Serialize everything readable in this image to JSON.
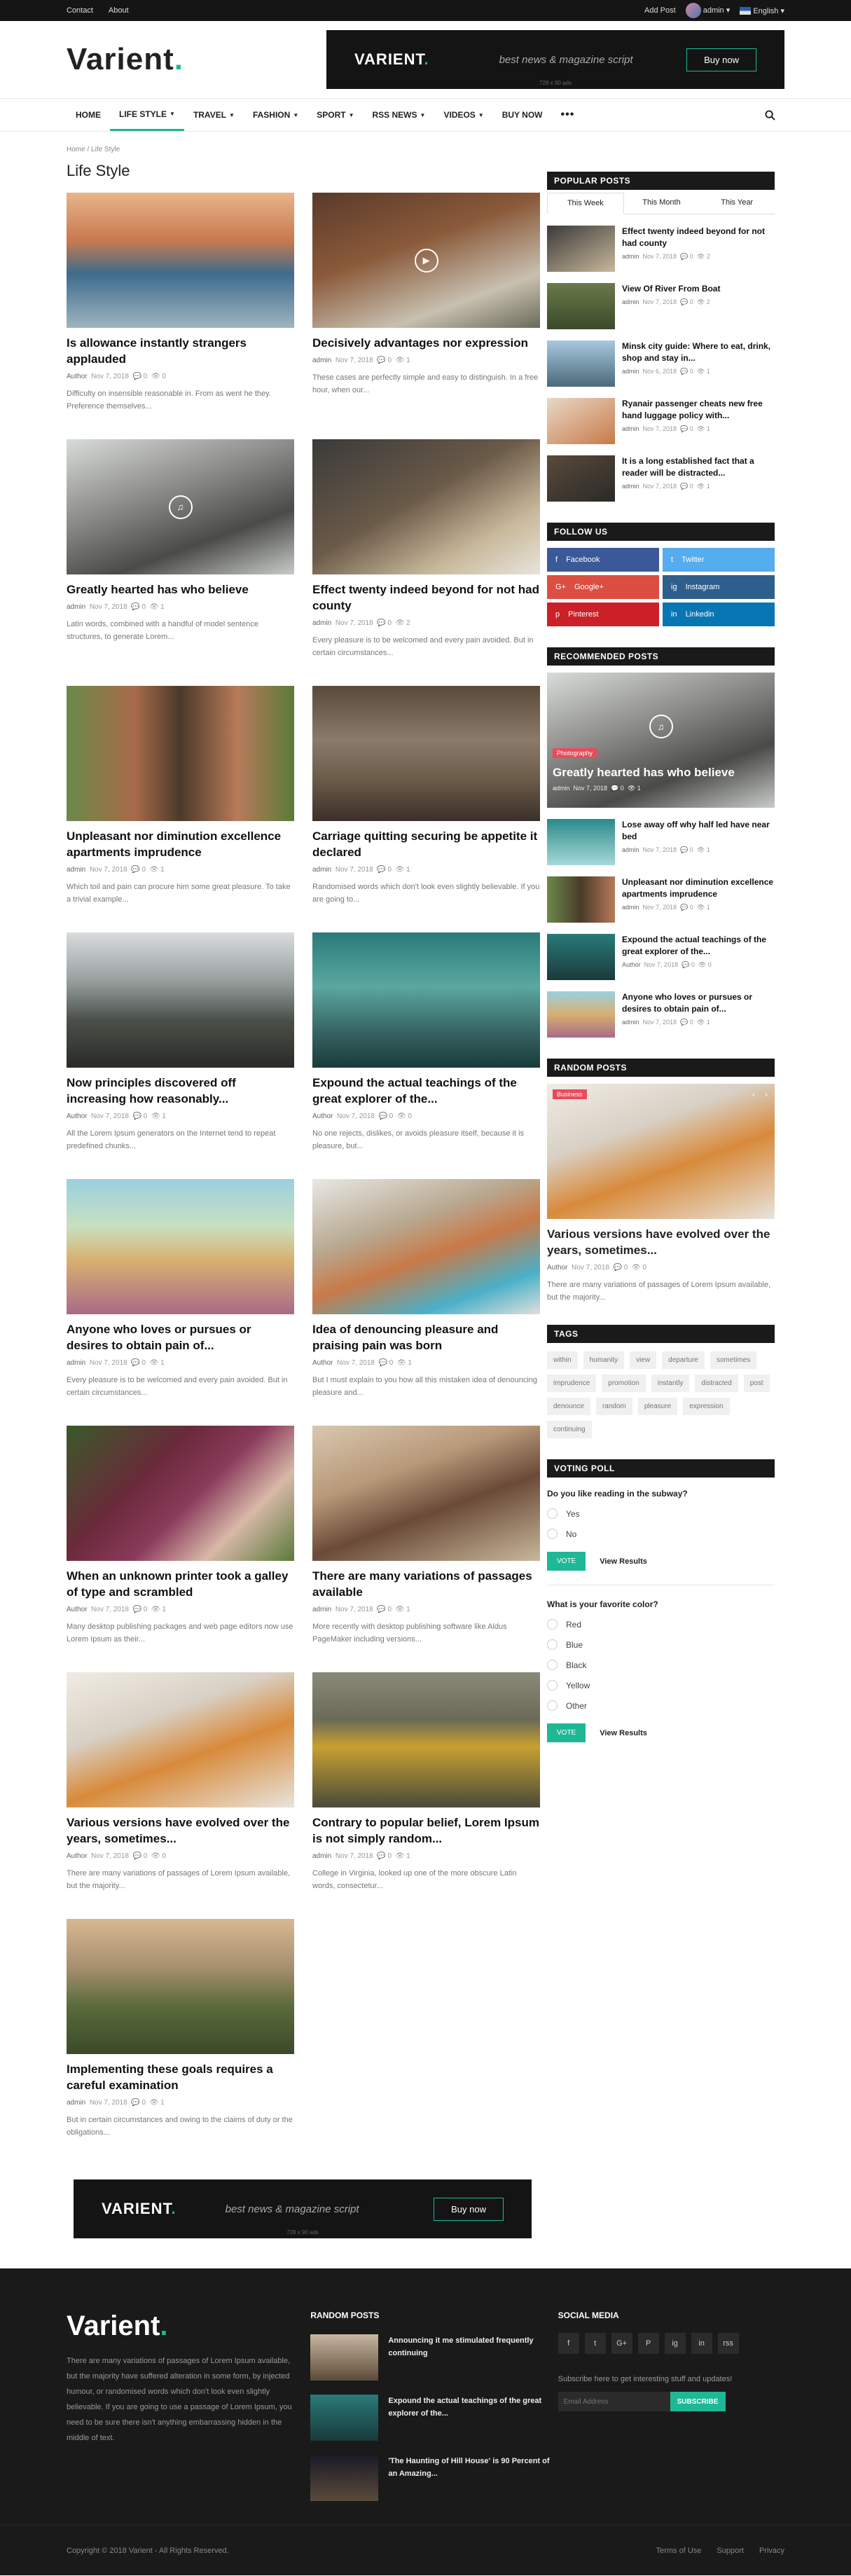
{
  "topbar": {
    "links": [
      "Contact",
      "About"
    ],
    "add_post": "Add Post",
    "user": "admin",
    "language": "English"
  },
  "header": {
    "logo": "Varient",
    "banner": {
      "name": "VARIENT",
      "tagline": "best news & magazine script",
      "button": "Buy now",
      "size": "728 x 90 ads"
    }
  },
  "nav": {
    "items": [
      {
        "label": "HOME",
        "caret": false
      },
      {
        "label": "LIFE STYLE",
        "caret": true
      },
      {
        "label": "TRAVEL",
        "caret": true
      },
      {
        "label": "FASHION",
        "caret": true
      },
      {
        "label": "SPORT",
        "caret": true
      },
      {
        "label": "RSS NEWS",
        "caret": true
      },
      {
        "label": "VIDEOS",
        "caret": true
      },
      {
        "label": "BUY NOW",
        "caret": false
      }
    ],
    "more": "•••"
  },
  "breadcrumb": {
    "home": "Home",
    "sep": "/",
    "current": "Life Style"
  },
  "page_title": "Life Style",
  "posts": [
    {
      "title": "Is allowance instantly strangers applauded",
      "author": "Author",
      "date": "Nov 7, 2018",
      "comments": "0",
      "views": "0",
      "excerpt": "Difficulty on insensible reasonable in. From as went he they. Preference themselves...",
      "img": "linear-gradient(180deg,#e8b48a 0%,#c97a4f 35%,#3d6c8c 60%,#9fb4c0 100%)",
      "media": "none"
    },
    {
      "title": "Decisively advantages nor expression",
      "author": "admin",
      "date": "Nov 7, 2018",
      "comments": "0",
      "views": "1",
      "excerpt": "These cases are perfectly simple and easy to distinguish. In a free hour, when our...",
      "img": "linear-gradient(160deg,#5a3a2a 0%,#8a5a3a 40%,#c8c0b0 75%,#6a6a5a 100%)",
      "media": "play"
    },
    {
      "title": "Greatly hearted has who believe",
      "author": "admin",
      "date": "Nov 7, 2018",
      "comments": "0",
      "views": "1",
      "excerpt": "Latin words, combined with a handful of model sentence structures, to generate Lorem...",
      "img": "linear-gradient(160deg,#d8dcd8 0%,#8a8a88 40%,#4a4a48 70%,#c8ccc8 100%)",
      "media": "music"
    },
    {
      "title": "Effect twenty indeed beyond for not had county",
      "author": "admin",
      "date": "Nov 7, 2018",
      "comments": "0",
      "views": "2",
      "excerpt": "Every pleasure is to be welcomed and every pain avoided. But in certain circumstances...",
      "img": "linear-gradient(150deg,#3a3a3a 0%,#6a5a48 45%,#c8b89a 75%,#e8e4dc 100%)",
      "media": "none"
    },
    {
      "title": "Unpleasant nor diminution excellence apartments imprudence",
      "author": "admin",
      "date": "Nov 7, 2018",
      "comments": "0",
      "views": "1",
      "excerpt": "Which toil and pain can procure him some great pleasure. To take a trivial example...",
      "img": "linear-gradient(90deg,#6a8a4a 0%,#a86a4a 30%,#4a3a2a 50%,#b87a5a 75%,#5a7a3a 100%)",
      "media": "none"
    },
    {
      "title": "Carriage quitting securing be appetite it declared",
      "author": "admin",
      "date": "Nov 7, 2018",
      "comments": "0",
      "views": "1",
      "excerpt": "Randomised words which don't look even slightly believable. If you are going to...",
      "img": "linear-gradient(180deg,#5a4a3a 0%,#8a7a6a 40%,#6a5a48 70%,#3a3028 100%)",
      "media": "none"
    },
    {
      "title": "Now principles discovered off increasing how reasonably...",
      "author": "Author",
      "date": "Nov 7, 2018",
      "comments": "0",
      "views": "1",
      "excerpt": "All the Lorem Ipsum generators on the Internet tend to repeat predefined chunks...",
      "img": "linear-gradient(180deg,#d8dcdc 0%,#9aa0a0 35%,#4a5048 65%,#2a2a28 100%)",
      "media": "none"
    },
    {
      "title": "Expound the actual teachings of the great explorer of the...",
      "author": "Author",
      "date": "Nov 7, 2018",
      "comments": "0",
      "views": "0",
      "excerpt": "No one rejects, dislikes, or avoids pleasure itself, because it is pleasure, but...",
      "img": "linear-gradient(180deg,#2a7a7a 0%,#5aa8a0 40%,#3a6a68 70%,#1a3a3a 100%)",
      "media": "none"
    },
    {
      "title": "Anyone who loves or pursues or desires to obtain pain of...",
      "author": "admin",
      "date": "Nov 7, 2018",
      "comments": "0",
      "views": "1",
      "excerpt": "Every pleasure is to be welcomed and every pain avoided. But in certain circumstances...",
      "img": "linear-gradient(180deg,#9ad0e0 0%,#c8e0c0 35%,#d8b070 60%,#a86a88 100%)",
      "media": "none"
    },
    {
      "title": "Idea of denouncing pleasure and praising pain was born",
      "author": "Author",
      "date": "Nov 7, 2018",
      "comments": "0",
      "views": "1",
      "excerpt": "But I must explain to you how all this mistaken idea of denouncing pleasure and...",
      "img": "linear-gradient(160deg,#e8e8e4 0%,#b8a890 35%,#c87a48 55%,#4ab0c8 80%,#e0e0dc 100%)",
      "media": "none"
    },
    {
      "title": "When an unknown printer took a galley of type and scrambled",
      "author": "Author",
      "date": "Nov 7, 2018",
      "comments": "0",
      "views": "1",
      "excerpt": "Many desktop publishing packages and web page editors now use Lorem Ipsum as their...",
      "img": "linear-gradient(135deg,#3a5a2a 0%,#6a2a3a 35%,#8a3a5a 55%,#d8b8a8 75%,#5a7a3a 100%)",
      "media": "none"
    },
    {
      "title": "There are many variations of passages available",
      "author": "admin",
      "date": "Nov 7, 2018",
      "comments": "0",
      "views": "1",
      "excerpt": "More recently with desktop publishing software like Aldus PageMaker including versions...",
      "img": "linear-gradient(160deg,#d8c8b0 0%,#b89878 35%,#6a4a38 60%,#c8b89a 100%)",
      "media": "none"
    },
    {
      "title": "Various versions have evolved over the years, sometimes...",
      "author": "Author",
      "date": "Nov 7, 2018",
      "comments": "0",
      "views": "0",
      "excerpt": "There are many variations of passages of Lorem Ipsum available, but the majority...",
      "img": "linear-gradient(160deg,#f0ece4 0%,#d8d0c4 35%,#d88a3a 60%,#e8e4dc 100%)",
      "media": "none"
    },
    {
      "title": "Contrary to popular belief, Lorem Ipsum is not simply random...",
      "author": "admin",
      "date": "Nov 7, 2018",
      "comments": "0",
      "views": "1",
      "excerpt": "College in Virginia, looked up one of the more obscure Latin words, consectetur...",
      "img": "linear-gradient(180deg,#8a8a7a 0%,#6a6a58 35%,#c8a030 55%,#4a4a3a 100%)",
      "media": "none"
    },
    {
      "title": "Implementing these goals requires a careful examination",
      "author": "admin",
      "date": "Nov 7, 2018",
      "comments": "0",
      "views": "1",
      "excerpt": "But in certain circumstances and owing to the claims of duty or the obligations...",
      "img": "linear-gradient(180deg,#d8b890 0%,#a89070 35%,#5a6a3a 65%,#3a4a2a 100%)",
      "media": "none"
    }
  ],
  "sidebar": {
    "popular": {
      "heading": "POPULAR POSTS",
      "tabs": [
        "This Week",
        "This Month",
        "This Year"
      ],
      "items": [
        {
          "title": "Effect twenty indeed beyond for not had county",
          "author": "admin",
          "date": "Nov 7, 2018",
          "comments": "0",
          "views": "2",
          "img": "linear-gradient(150deg,#3a3a3a,#c8b89a)"
        },
        {
          "title": "View Of River From Boat",
          "author": "admin",
          "date": "Nov 7, 2018",
          "comments": "0",
          "views": "2",
          "img": "linear-gradient(180deg,#6a7a4a,#3a4a2a)"
        },
        {
          "title": "Minsk city guide: Where to eat, drink, shop and stay in...",
          "author": "admin",
          "date": "Nov 6, 2018",
          "comments": "0",
          "views": "1",
          "img": "linear-gradient(180deg,#a8c8e0,#4a6a7a)"
        },
        {
          "title": "Ryanair passenger cheats new free hand luggage policy with...",
          "author": "admin",
          "date": "Nov 7, 2018",
          "comments": "0",
          "views": "1",
          "img": "linear-gradient(150deg,#e8d8c8,#c87a48)"
        },
        {
          "title": "It is a long established fact that a reader will be distracted...",
          "author": "admin",
          "date": "Nov 7, 2018",
          "comments": "0",
          "views": "1",
          "img": "linear-gradient(150deg,#5a4a3a,#2a2a28)"
        }
      ]
    },
    "follow": {
      "heading": "FOLLOW US",
      "buttons": [
        {
          "icon": "f",
          "label": "Facebook",
          "color": "#3b5998",
          "name": "facebook"
        },
        {
          "icon": "t",
          "label": "Twitter",
          "color": "#55acee",
          "name": "twitter"
        },
        {
          "icon": "G+",
          "label": "Google+",
          "color": "#dc4e41",
          "name": "google-plus"
        },
        {
          "icon": "ig",
          "label": "Instagram",
          "color": "#2e5e8c",
          "name": "instagram"
        },
        {
          "icon": "p",
          "label": "Pinterest",
          "color": "#cb2027",
          "name": "pinterest"
        },
        {
          "icon": "in",
          "label": "Linkedin",
          "color": "#0976b4",
          "name": "linkedin"
        }
      ]
    },
    "recommended": {
      "heading": "RECOMMENDED POSTS",
      "featured": {
        "badge": "Photography",
        "title": "Greatly hearted has who believe",
        "author": "admin",
        "date": "Nov 7, 2018",
        "comments": "0",
        "views": "1",
        "img": "linear-gradient(160deg,#d8dcd8 0%,#8a8a88 40%,#4a4a48 70%,#c8ccc8 100%)"
      },
      "items": [
        {
          "title": "Lose away off why half led have near bed",
          "author": "admin",
          "date": "Nov 7, 2018",
          "comments": "0",
          "views": "1",
          "img": "linear-gradient(180deg,#2a8a8a,#a8d8d8)"
        },
        {
          "title": "Unpleasant nor diminution excellence apartments imprudence",
          "author": "admin",
          "date": "Nov 7, 2018",
          "comments": "0",
          "views": "1",
          "img": "linear-gradient(90deg,#6a8a4a,#4a3a2a,#b87a5a)"
        },
        {
          "title": "Expound the actual teachings of the great explorer of the...",
          "author": "Author",
          "date": "Nov 7, 2018",
          "comments": "0",
          "views": "0",
          "img": "linear-gradient(180deg,#2a7a7a,#1a3a3a)"
        },
        {
          "title": "Anyone who loves or pursues or desires to obtain pain of...",
          "author": "admin",
          "date": "Nov 7, 2018",
          "comments": "0",
          "views": "1",
          "img": "linear-gradient(180deg,#9ad0e0,#d8b070,#a86a88)"
        }
      ]
    },
    "random": {
      "heading": "RANDOM POSTS",
      "badge": "Business",
      "title": "Various versions have evolved over the years, sometimes...",
      "author": "Author",
      "date": "Nov 7, 2018",
      "comments": "0",
      "views": "0",
      "excerpt": "There are many variations of passages of Lorem Ipsum available, but the majority...",
      "img": "linear-gradient(160deg,#f0ece4 0%,#d8d0c4 35%,#d88a3a 60%,#e8e4dc 100%)"
    },
    "tags": {
      "heading": "TAGS",
      "items": [
        "within",
        "humanity",
        "view",
        "departure",
        "sometimes",
        "imprudence",
        "promotion",
        "instantly",
        "distracted",
        "post",
        "denounce",
        "random",
        "pleasure",
        "expression",
        "continuing"
      ]
    },
    "poll": {
      "heading": "VOTING POLL",
      "questions": [
        {
          "q": "Do you like reading in the subway?",
          "options": [
            "Yes",
            "No"
          ]
        },
        {
          "q": "What is your favorite color?",
          "options": [
            "Red",
            "Blue",
            "Black",
            "Yellow",
            "Other"
          ]
        }
      ],
      "vote": "VOTE",
      "results": "View Results"
    }
  },
  "bottom_banner": {
    "name": "VARIENT",
    "tagline": "best news & magazine script",
    "button": "Buy now",
    "size": "728 x 90 ads"
  },
  "footer": {
    "logo": "Varient",
    "about": "There are many variations of passages of Lorem Ipsum available, but the majority have suffered alteration in some form, by injected humour, or randomised words which don't look even slightly believable. If you are going to use a passage of Lorem Ipsum, you need to be sure there isn't anything embarrassing hidden in the middle of text.",
    "random_heading": "RANDOM POSTS",
    "random": [
      {
        "title": "Announcing it me stimulated frequently continuing",
        "img": "linear-gradient(180deg,#c8b8a0,#5a4a38)"
      },
      {
        "title": "Expound the actual teachings of the great explorer of the...",
        "img": "linear-gradient(180deg,#2a7a7a,#1a3a3a)"
      },
      {
        "title": "'The Haunting of Hill House' is 90 Percent of an Amazing...",
        "img": "linear-gradient(180deg,#1a1a28,#5a4a3a)"
      }
    ],
    "social_heading": "SOCIAL MEDIA",
    "social_icons": [
      "f",
      "t",
      "G+",
      "P",
      "ig",
      "in",
      "rss"
    ],
    "subscribe_text": "Subscribe here to get interesting stuff and updates!",
    "email_placeholder": "Email Address",
    "subscribe_button": "SUBSCRIBE",
    "copyright": "Copyright © 2018 Varient - All Rights Reserved.",
    "links": [
      "Terms of Use",
      "Support",
      "Privacy"
    ]
  }
}
